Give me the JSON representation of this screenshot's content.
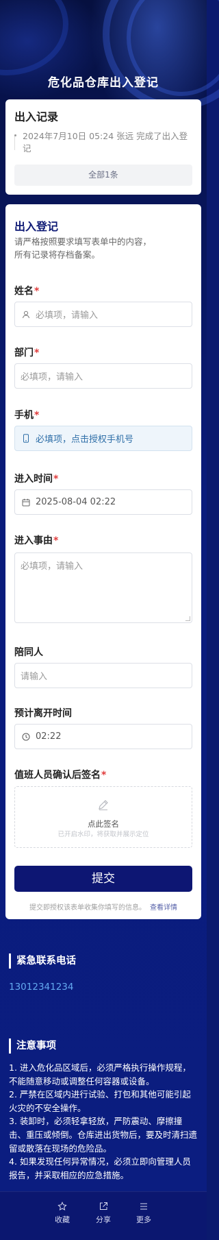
{
  "page_title": "危化品仓库出入登记",
  "records": {
    "title": "出入记录",
    "items": [
      {
        "text": "2024年7月10日 05:24  张远  完成了出入登记"
      }
    ],
    "all_label": "全部1条"
  },
  "form": {
    "heading": "出入登记",
    "description_lines": [
      "请严格按照要求填写表单中的内容，",
      "所有记录将存档备案。"
    ],
    "name": {
      "label": "姓名",
      "required": "*",
      "placeholder": "必填项，请输入"
    },
    "department": {
      "label": "部门",
      "required": "*",
      "placeholder": "必填项，请输入"
    },
    "phone": {
      "label": "手机",
      "required": "*",
      "placeholder": "必填项，点击授权手机号"
    },
    "entry_time": {
      "label": "进入时间",
      "required": "*",
      "value": "2025-08-04 02:22"
    },
    "reason": {
      "label": "进入事由",
      "required": "*",
      "placeholder": "必填项，请输入"
    },
    "companion": {
      "label": "陪同人",
      "placeholder": "请输入"
    },
    "leave_time": {
      "label": "预计离开时间",
      "value": "02:22"
    },
    "signature": {
      "label": "值班人员确认后签名",
      "required": "*",
      "action_text": "点此签名",
      "hint": "已开启水印，将获取并展示定位"
    },
    "submit_label": "提交",
    "consent_text": "提交即授权该表单收集你填写的信息。",
    "consent_link": "查看详情"
  },
  "emergency": {
    "title": "紧急联系电话",
    "phone": "13012341234"
  },
  "notice": {
    "title": "注意事项",
    "items": [
      "1. 进入危化品区域后，必须严格执行操作规程，不能随意移动或调整任何容器或设备。",
      "2. 严禁在区域内进行试验、打包和其他可能引起火灾的不安全操作。",
      "3. 装卸时，必须轻拿轻放，严防震动、摩擦撞击、重压或倾倒。仓库进出货物后，要及时清扫遗留或散落在现场的危险品。",
      "4. 如果发现任何异常情况，必须立即向管理人员报告，并采取相应的应急措施。"
    ]
  },
  "tabbar": {
    "items": [
      {
        "label": "收藏",
        "icon": "star-icon"
      },
      {
        "label": "分享",
        "icon": "share-icon"
      },
      {
        "label": "更多",
        "icon": "menu-icon"
      }
    ]
  },
  "colors": {
    "primary": "#0d1673",
    "background": "#0b1a6e",
    "required": "#e03b3b",
    "link": "#64a9f0"
  }
}
